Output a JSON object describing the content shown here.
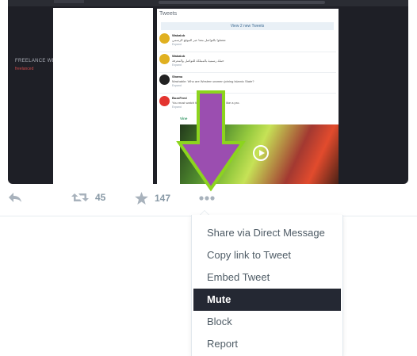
{
  "media": {
    "site_title": "FREELANCE WEB D",
    "site_subtitle": "freelanced",
    "tweets_panel": {
      "header": "Tweets",
      "new_tweets_bar": "View 2 new Tweets",
      "items": [
        {
          "name": "Wakalub",
          "text": "تفضلوا بالتواصل معنا عبر الموقع الرسمي",
          "expand": "Expand"
        },
        {
          "name": "Wakalub",
          "text": "حملة رسمية بالمملكة للتواصل والمعرفة",
          "expand": "Expand"
        },
        {
          "name": "Shamu",
          "text": "Mashable: Who are Western women joining Islamic State?",
          "expand": "Expand"
        },
        {
          "name": "BuzzFeed",
          "text": "You must watch this amazing partying like a pro.",
          "expand": "Expand"
        }
      ],
      "vine_label": "Vine"
    }
  },
  "actions": {
    "retweet_count": "45",
    "favorite_count": "147"
  },
  "menu": {
    "items": [
      {
        "label": "Share via Direct Message"
      },
      {
        "label": "Copy link to Tweet"
      },
      {
        "label": "Embed Tweet"
      },
      {
        "label": "Mute"
      },
      {
        "label": "Block"
      },
      {
        "label": "Report"
      }
    ],
    "active_item": "Mute"
  },
  "icons": {
    "reply": "reply-icon",
    "retweet": "retweet-icon",
    "favorite": "star-icon",
    "more": "ellipsis-icon",
    "arrow": "down-arrow-annotation"
  },
  "colors": {
    "menu_highlight": "#242833",
    "arrow_fill": "#9b4eb0",
    "arrow_outline": "#8cd41e",
    "icon_gray": "#a8b2bc"
  }
}
